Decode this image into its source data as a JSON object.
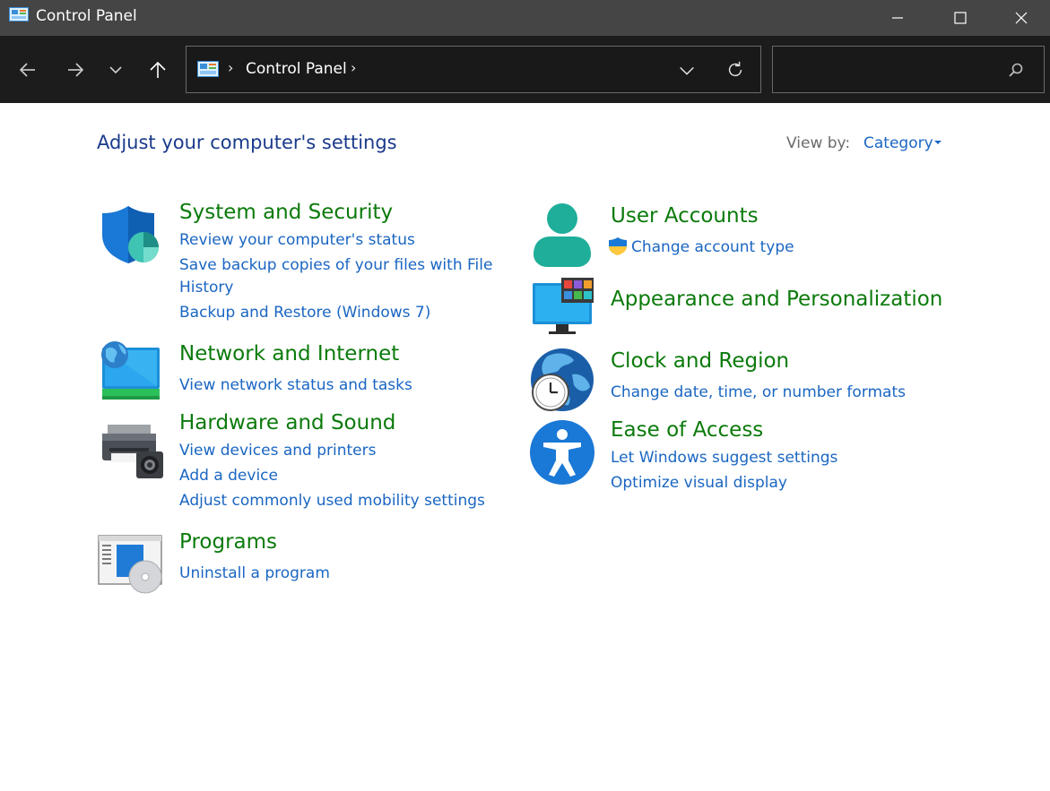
{
  "window": {
    "title": "Control Panel"
  },
  "address_bar": {
    "breadcrumb": "Control Panel",
    "separator": "›"
  },
  "search": {
    "placeholder": "",
    "value": ""
  },
  "header": {
    "title": "Adjust your computer's settings",
    "view_by_label": "View by:",
    "view_by_value": "Category"
  },
  "categories": {
    "system_security": {
      "title": "System and Security",
      "links": [
        "Review your computer's status",
        "Save backup copies of your files with File",
        "History",
        "Backup and Restore (Windows 7)"
      ]
    },
    "network_internet": {
      "title": "Network and Internet",
      "links": [
        "View network status and tasks"
      ]
    },
    "hardware_sound": {
      "title": "Hardware and Sound",
      "links": [
        "View devices and printers",
        "Add a device",
        "Adjust commonly used mobility settings"
      ]
    },
    "programs": {
      "title": "Programs",
      "links": [
        "Uninstall a program"
      ]
    },
    "user_accounts": {
      "title": "User Accounts",
      "links": [
        "Change account type"
      ]
    },
    "appearance": {
      "title": "Appearance and Personalization",
      "links": []
    },
    "clock_region": {
      "title": "Clock and Region",
      "links": [
        "Change date, time, or number formats"
      ]
    },
    "ease_access": {
      "title": "Ease of Access",
      "links": [
        "Let Windows suggest settings",
        "Optimize visual display"
      ]
    }
  },
  "icons": {
    "app": "control-panel-icon",
    "back": "arrow-left-icon",
    "forward": "arrow-right-icon",
    "recent": "chevron-down-icon",
    "up": "arrow-up-icon",
    "refresh": "refresh-icon",
    "search": "search-icon"
  },
  "colors": {
    "title_bar": "#454545",
    "nav_bar": "#1c1c1c",
    "category_title": "#0b7a0b",
    "link": "#1a66c2",
    "page_title": "#1a3a8c"
  }
}
